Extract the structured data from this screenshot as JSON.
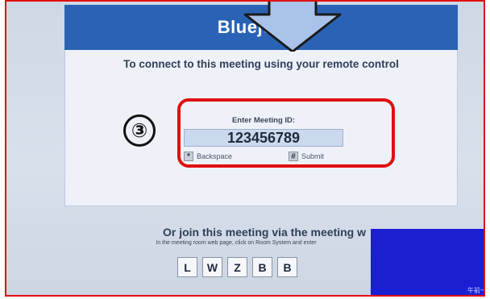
{
  "dialog": {
    "brand_title": "Bluejeans",
    "subtitle": "To connect to this meeting using your remote control",
    "meeting_id_label": "Enter Meeting ID:",
    "meeting_id_value": "123456789",
    "backspace_key": "*",
    "backspace_label": "Backspace",
    "submit_key": "#",
    "submit_label": "Submit"
  },
  "annotation": {
    "step_number": "③",
    "highlight_color": "#e01010",
    "arrow_color": "#a9c3ea"
  },
  "join": {
    "title": "Or join this meeting via the meeting w",
    "instructions": "In the meeting room web page, click on Room System and enter",
    "letters": [
      "L",
      "W",
      "Z",
      "B",
      "B"
    ]
  },
  "overlay": {
    "corner_text": "午前一"
  },
  "colors": {
    "header_blue": "#2a63b6",
    "overlay_blue": "#1a1fd2"
  }
}
